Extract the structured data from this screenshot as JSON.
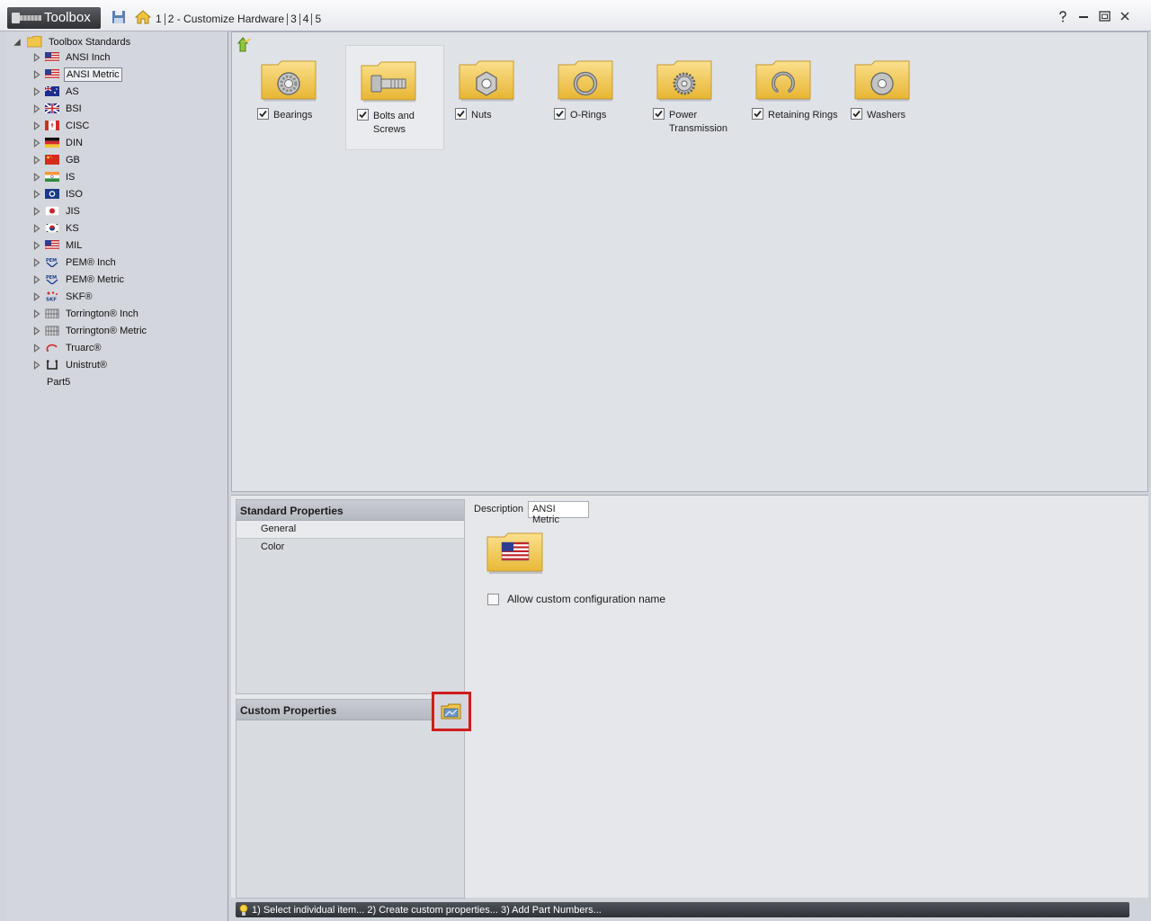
{
  "title_bar": {
    "app_name": "Toolbox",
    "breadcrumbs": [
      "1",
      "2 - Customize Hardware",
      "3",
      "4",
      "5"
    ]
  },
  "tree": {
    "root_label": "Toolbox Standards",
    "items": [
      {
        "label": "ANSI Inch",
        "icon": "us-flag-icon",
        "selected": false
      },
      {
        "label": "ANSI Metric",
        "icon": "us-flag-icon",
        "selected": true
      },
      {
        "label": "AS",
        "icon": "australia-flag-icon",
        "selected": false
      },
      {
        "label": "BSI",
        "icon": "uk-flag-icon",
        "selected": false
      },
      {
        "label": "CISC",
        "icon": "canada-flag-icon",
        "selected": false
      },
      {
        "label": "DIN",
        "icon": "germany-flag-icon",
        "selected": false
      },
      {
        "label": "GB",
        "icon": "china-flag-icon",
        "selected": false
      },
      {
        "label": "IS",
        "icon": "india-flag-icon",
        "selected": false
      },
      {
        "label": "ISO",
        "icon": "iso-icon",
        "selected": false
      },
      {
        "label": "JIS",
        "icon": "japan-flag-icon",
        "selected": false
      },
      {
        "label": "KS",
        "icon": "korea-flag-icon",
        "selected": false
      },
      {
        "label": "MIL",
        "icon": "us-flag-icon",
        "selected": false
      },
      {
        "label": "PEM® Inch",
        "icon": "pem-logo-icon",
        "selected": false
      },
      {
        "label": "PEM® Metric",
        "icon": "pem-logo-icon",
        "selected": false
      },
      {
        "label": "SKF®",
        "icon": "skf-logo-icon",
        "selected": false
      },
      {
        "label": "Torrington® Inch",
        "icon": "torrington-logo-icon",
        "selected": false
      },
      {
        "label": "Torrington® Metric",
        "icon": "torrington-logo-icon",
        "selected": false
      },
      {
        "label": "Truarc®",
        "icon": "truarc-logo-icon",
        "selected": false
      },
      {
        "label": "Unistrut®",
        "icon": "unistrut-logo-icon",
        "selected": false
      }
    ],
    "extra_item": "Part5"
  },
  "categories": [
    {
      "label": "Bearings",
      "icon": "bearing-icon",
      "checked": true
    },
    {
      "label": "Bolts and Screws",
      "icon": "bolt-icon",
      "checked": true
    },
    {
      "label": "Nuts",
      "icon": "nut-icon",
      "checked": true
    },
    {
      "label": "O-Rings",
      "icon": "o-ring-icon",
      "checked": true
    },
    {
      "label": "Power Transmission",
      "icon": "gear-icon",
      "checked": true
    },
    {
      "label": "Retaining Rings",
      "icon": "retaining-ring-icon",
      "checked": true
    },
    {
      "label": "Washers",
      "icon": "washer-icon",
      "checked": true
    }
  ],
  "standard_properties": {
    "header": "Standard Properties",
    "items": [
      "General",
      "Color"
    ],
    "selected": "General"
  },
  "custom_properties": {
    "header": "Custom Properties"
  },
  "general": {
    "description_label": "Description",
    "description_value": "ANSI Metric",
    "allow_custom_label": "Allow custom configuration name",
    "allow_custom_checked": false
  },
  "status": {
    "text": "1) Select individual item... 2) Create custom properties... 3) Add Part Numbers..."
  },
  "colors": {
    "folder": "#f4cd55",
    "highlight_border": "#d01c1c",
    "status_bar": "#3d4046"
  }
}
